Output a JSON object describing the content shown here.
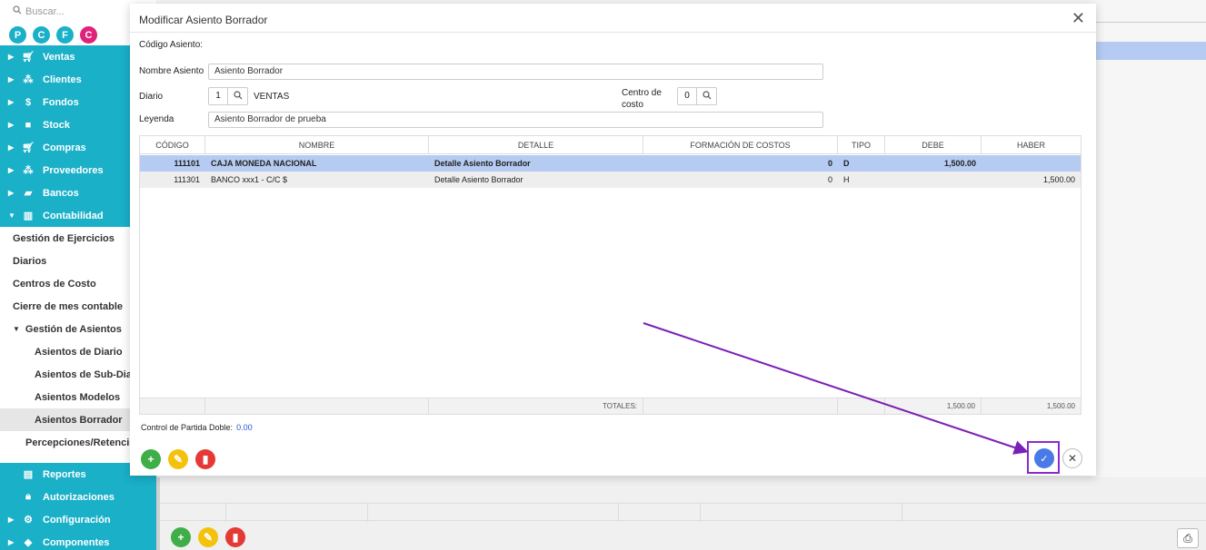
{
  "sidebar": {
    "search_placeholder": "Buscar...",
    "avatars": [
      {
        "letter": "P",
        "color": "#1ab0c8"
      },
      {
        "letter": "C",
        "color": "#1ab0c8"
      },
      {
        "letter": "F",
        "color": "#1ab0c8"
      },
      {
        "letter": "C",
        "color": "#e0227a"
      }
    ],
    "top_items": [
      {
        "label": "Ventas",
        "icon": "cart-icon"
      },
      {
        "label": "Clientes",
        "icon": "people-icon"
      },
      {
        "label": "Fondos",
        "icon": "dollar-icon"
      },
      {
        "label": "Stock",
        "icon": "box-icon"
      },
      {
        "label": "Compras",
        "icon": "cart-icon"
      },
      {
        "label": "Proveedores",
        "icon": "people-icon"
      },
      {
        "label": "Bancos",
        "icon": "briefcase-icon"
      },
      {
        "label": "Contabilidad",
        "icon": "book-icon"
      }
    ],
    "sub_items": [
      "Gestión de Ejercicios",
      "Diarios",
      "Centros de Costo",
      "Cierre de mes contable",
      "Gestión de Asientos",
      "Asientos de Diario",
      "Asientos de Sub-Diario",
      "Asientos Modelos",
      "Asientos Borrador",
      "Percepciones/Retenciones"
    ],
    "bottom_items": [
      {
        "label": "Reportes",
        "icon": "report-icon"
      },
      {
        "label": "Autorizaciones",
        "icon": "lock-icon"
      },
      {
        "label": "Configuración",
        "icon": "gears-icon"
      },
      {
        "label": "Componentes",
        "icon": "puzzle-icon"
      }
    ]
  },
  "modal": {
    "title": "Modificar Asiento Borrador",
    "codigo_label": "Código Asiento:",
    "nombre_label": "Nombre Asiento",
    "nombre_value": "Asiento Borrador",
    "diario_label": "Diario",
    "diario_num": "1",
    "diario_name": "VENTAS",
    "centro_label_1": "Centro de",
    "centro_label_2": "costo",
    "centro_value": "0",
    "leyenda_label": "Leyenda",
    "leyenda_value": "Asiento Borrador de prueba",
    "columns": [
      "CÓDIGO",
      "NOMBRE",
      "DETALLE",
      "FORMACIÓN DE COSTOS",
      "TIPO",
      "DEBE",
      "HABER"
    ],
    "rows": [
      {
        "codigo": "111101",
        "nombre": "CAJA MONEDA NACIONAL",
        "detalle": "Detalle Asiento Borrador",
        "formacion": "0",
        "tipo": "D",
        "debe": "1,500.00",
        "haber": ""
      },
      {
        "codigo": "111301",
        "nombre": "BANCO xxx1 - C/C $",
        "detalle": "Detalle Asiento Borrador",
        "formacion": "0",
        "tipo": "H",
        "debe": "",
        "haber": "1,500.00"
      }
    ],
    "totals_label": "TOTALES:",
    "total_debe": "1,500.00",
    "total_haber": "1,500.00",
    "partida_label": "Control de Partida Doble:",
    "partida_value": "0.00"
  },
  "colors": {
    "teal": "#1ab0c8",
    "selected_row": "#b5cbf2",
    "add_green": "#3fae49",
    "edit_yellow": "#f4c20d",
    "delete_red": "#e53935",
    "confirm_blue": "#4a79e8",
    "annotation_purple": "#7a1fb8"
  }
}
